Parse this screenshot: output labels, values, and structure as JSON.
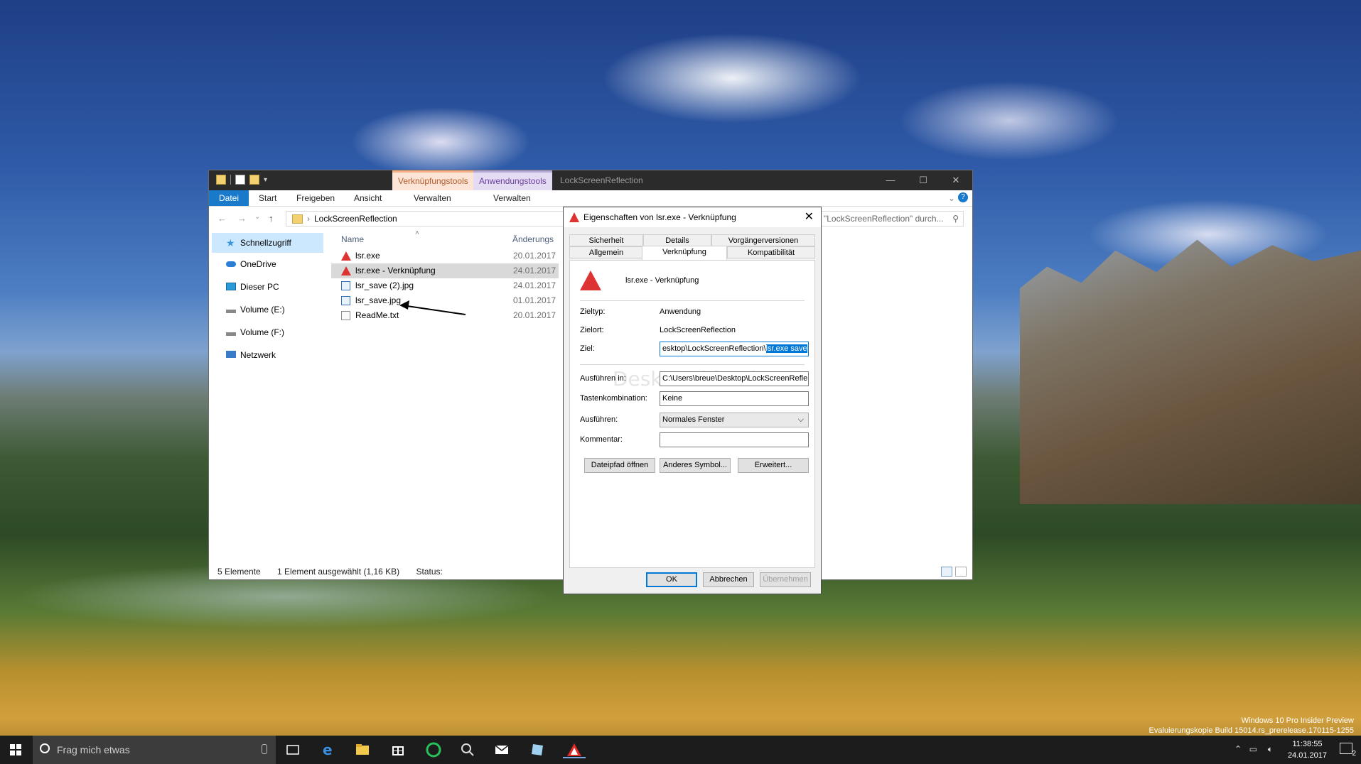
{
  "explorer": {
    "context_tabs": [
      "Verknüpfungstools",
      "Anwendungstools"
    ],
    "window_title": "LockScreenReflection",
    "ribbon": {
      "datei": "Datei",
      "start": "Start",
      "freigeben": "Freigeben",
      "ansicht": "Ansicht",
      "verwalten1": "Verwalten",
      "verwalten2": "Verwalten"
    },
    "address": "LockScreenReflection",
    "search_placeholder": "\"LockScreenReflection\" durch...",
    "nav": [
      {
        "label": "Schnellzugriff",
        "icon": "star-icon"
      },
      {
        "label": "OneDrive",
        "icon": "cloud-icon"
      },
      {
        "label": "Dieser PC",
        "icon": "pc-icon"
      },
      {
        "label": "Volume (E:)",
        "icon": "drive-icon"
      },
      {
        "label": "Volume (F:)",
        "icon": "drive-icon"
      },
      {
        "label": "Netzwerk",
        "icon": "network-icon"
      }
    ],
    "columns": {
      "name": "Name",
      "date": "Änderungs"
    },
    "files": [
      {
        "name": "lsr.exe",
        "date": "20.01.2017",
        "icon": "exe-icon"
      },
      {
        "name": "lsr.exe - Verknüpfung",
        "date": "24.01.2017",
        "icon": "exe-icon"
      },
      {
        "name": "lsr_save (2).jpg",
        "date": "24.01.2017",
        "icon": "jpg-icon"
      },
      {
        "name": "lsr_save.jpg",
        "date": "01.01.2017",
        "icon": "jpg-icon"
      },
      {
        "name": "ReadMe.txt",
        "date": "20.01.2017",
        "icon": "txt-icon"
      }
    ],
    "status": {
      "count": "5 Elemente",
      "selected": "1 Element ausgewählt (1,16 KB)",
      "label": "Status:"
    }
  },
  "dialog": {
    "title": "Eigenschaften von lsr.exe - Verknüpfung",
    "tabs_row1": [
      "Sicherheit",
      "Details",
      "Vorgängerversionen"
    ],
    "tabs_row2": [
      "Allgemein",
      "Verknüpfung",
      "Kompatibilität"
    ],
    "shortcut_name": "lsr.exe - Verknüpfung",
    "zieltyp_label": "Zieltyp:",
    "zieltyp": "Anwendung",
    "zielort_label": "Zielort:",
    "zielort": "LockScreenReflection",
    "ziel_label": "Ziel:",
    "ziel_prefix": "esktop\\LockScreenReflection\\",
    "ziel_selected": "lsr.exe save",
    "ausfuehren_in_label": "Ausführen in:",
    "ausfuehren_in": "C:\\Users\\breue\\Desktop\\LockScreenRefle",
    "tasten_label": "Tastenkombination:",
    "tasten": "Keine",
    "ausfuehren_label": "Ausführen:",
    "ausfuehren": "Normales Fenster",
    "kommentar_label": "Kommentar:",
    "kommentar": "",
    "btn_dateipfad": "Dateipfad öffnen",
    "btn_symbol": "Anderes Symbol...",
    "btn_erweitert": "Erweitert...",
    "btn_ok": "OK",
    "btn_abbrechen": "Abbrechen",
    "btn_uebernehmen": "Übernehmen",
    "watermark": "Deskmodder.de"
  },
  "desktop_watermark": {
    "line1": "Windows 10 Pro Insider Preview",
    "line2": "Evaluierungskopie Build 15014.rs_prerelease.170115-1255"
  },
  "taskbar": {
    "search_placeholder": "Frag mich etwas",
    "time": "11:38:55",
    "date": "24.01.2017",
    "notifications": "2"
  }
}
